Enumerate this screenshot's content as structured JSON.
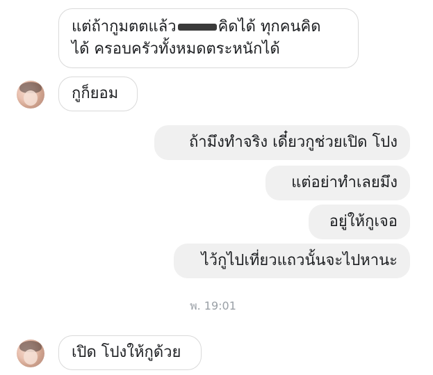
{
  "messages": [
    {
      "direction": "incoming",
      "lines": [
        "แต่ถ้ากูมตตแล้ว",
        "คิดได้ ทุกคนคิด",
        "ได้ ครอบครัวทั้งหมดตระหนักได้"
      ],
      "has_redaction": true
    },
    {
      "direction": "incoming",
      "text": "กูก็ยอม"
    },
    {
      "direction": "outgoing",
      "text": "ถ้ามึงทำจริง เดี๋ยวกูช่วยเปิด โปง"
    },
    {
      "direction": "outgoing",
      "text": "แต่อย่าทำเลยมึง"
    },
    {
      "direction": "outgoing",
      "text": "อยู่ให้กูเจอ"
    },
    {
      "direction": "outgoing",
      "text": "ไว้กูไปเที่ยวแถวนั้นจะไปหานะ"
    },
    {
      "direction": "incoming",
      "text": "เปิด โปงให้กูด้วย"
    }
  ],
  "timestamp": "พ. 19:01",
  "colors": {
    "incoming_bubble_bg": "#ffffff",
    "incoming_bubble_border": "#d9d9d9",
    "outgoing_bubble_bg": "#f0f0f0",
    "text": "#1c1e21",
    "timestamp": "#9aa0a6"
  }
}
